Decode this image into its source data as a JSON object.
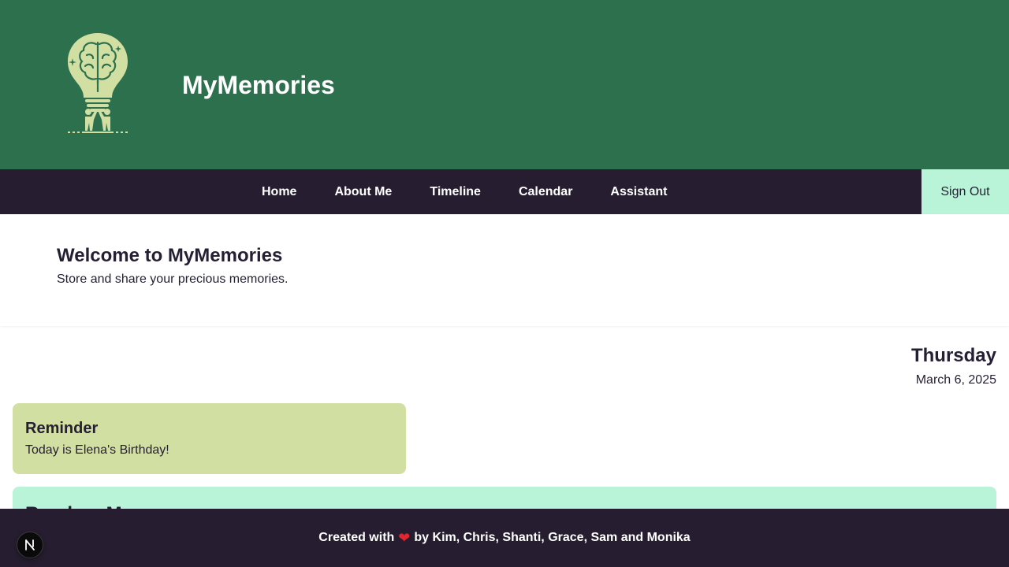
{
  "header": {
    "app_title": "MyMemories",
    "logo_icon": "brain-lightbulb-logo-icon",
    "background_color": "#2d704d",
    "logo_color": "#d2dfa3"
  },
  "nav": {
    "links": [
      "Home",
      "About Me",
      "Timeline",
      "Calendar",
      "Assistant"
    ],
    "sign_out": "Sign Out",
    "background_color": "#261e30",
    "sign_out_color": "#b9f4d9"
  },
  "welcome": {
    "title": "Welcome to MyMemories",
    "subtitle": "Store and share your precious memories."
  },
  "date_display": {
    "day": "Thursday",
    "date": "March 6, 2025"
  },
  "reminder": {
    "title": "Reminder",
    "text": "Today is Elena's Birthday!",
    "background_color": "#d2dfa3"
  },
  "memory_card": {
    "title": "Random Memory",
    "background_color": "#b9f4d9"
  },
  "footer": {
    "prefix": "Created with",
    "heart_icon": "heart-icon",
    "suffix": "by Kim, Chris, Shanti, Grace, Sam and Monika"
  },
  "dev_badge": {
    "icon": "next-n-icon",
    "label": "N"
  }
}
